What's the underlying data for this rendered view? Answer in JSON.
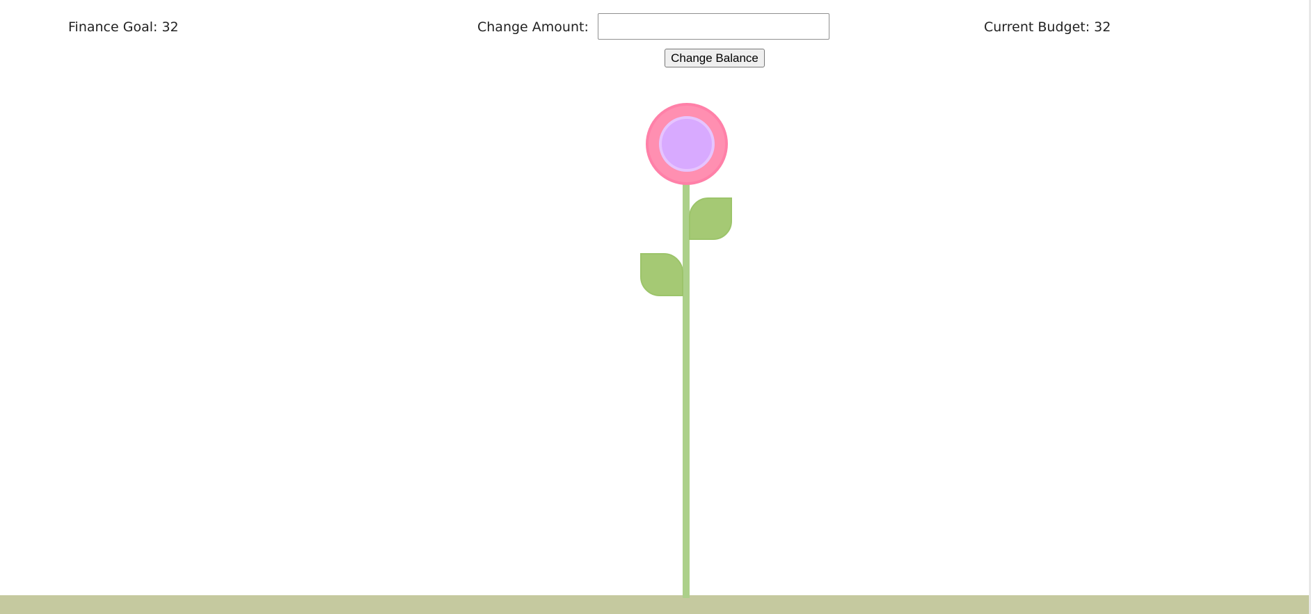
{
  "header": {
    "finance_goal": "Finance Goal: 32",
    "change_amount_label": "Change Amount:",
    "change_amount_value": "",
    "change_button_label": "Change Balance",
    "current_budget": "Current Budget: 32"
  },
  "plant": {
    "petal_color": "#ff8fb1",
    "petal_border_color": "#ff80a8",
    "center_color": "#d8aaff",
    "center_border_color": "#e6c4ff",
    "stem_color": "#acd08a",
    "leaf_color": "#a5c974",
    "ground_color": "#c5c99f"
  }
}
